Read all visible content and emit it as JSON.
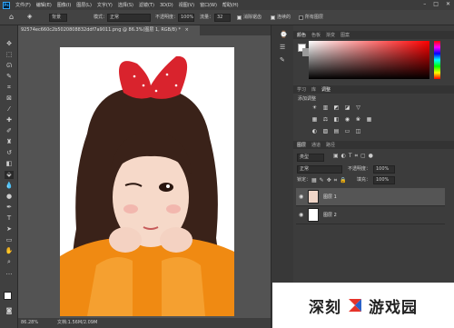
{
  "menubar": {
    "app_icon": "Ps",
    "items": [
      "文件(F)",
      "编辑(E)",
      "图像(I)",
      "图层(L)",
      "文字(Y)",
      "选择(S)",
      "滤镜(T)",
      "3D(D)",
      "视图(V)",
      "窗口(W)",
      "帮助(H)"
    ]
  },
  "options": {
    "mode_label": "模式：",
    "mode_value": "正常",
    "opacity_label": "不透明度：",
    "opacity_value": "100%",
    "flow_label": "流量：",
    "flow_value": "32",
    "chk1": "消除锯齿",
    "chk2": "连续的",
    "chk3": "所有图层",
    "preset": "背景"
  },
  "document": {
    "tab_title": "92574ec660c2b5020808832ddf7a9011.png @ 86.3%(图层 1, RGB/8) *",
    "close": "×"
  },
  "status": {
    "zoom": "86.28%",
    "doc": "文档:1.56M/2.09M"
  },
  "color_panel": {
    "tabs": [
      "颜色",
      "色板",
      "渐变",
      "图案"
    ],
    "fg": "#ffffff",
    "bg": "#9a9a9a"
  },
  "adjust_panel": {
    "tabs": [
      "学习",
      "库",
      "调整"
    ],
    "title": "添加调整"
  },
  "layers_panel": {
    "tabs": [
      "图层",
      "通道",
      "路径"
    ],
    "kind": "类型",
    "blend": "正常",
    "opacity_label": "不透明度：",
    "opacity": "100%",
    "lock_label": "锁定：",
    "fill_label": "填充：",
    "fill": "100%",
    "layers": [
      {
        "name": "图层 1"
      },
      {
        "name": "图层 2"
      }
    ]
  },
  "watermark": {
    "text1": "深刻",
    "text2": "游戏园"
  },
  "colors": {
    "accent": "#31a8ff",
    "selected_layer": "#555555"
  }
}
